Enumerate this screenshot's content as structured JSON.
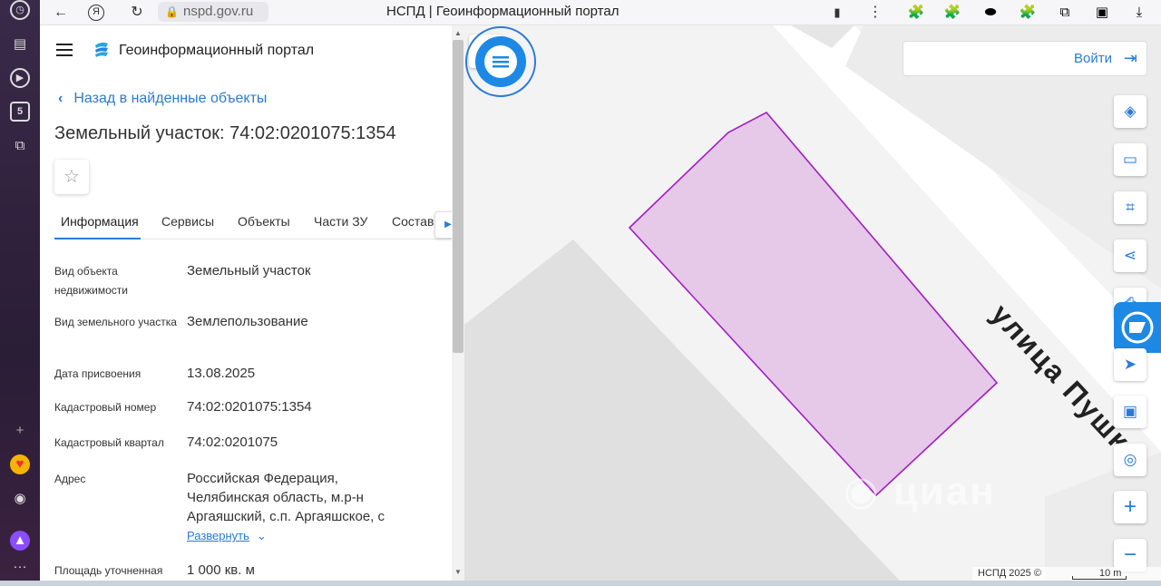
{
  "browser": {
    "url": "nspd.gov.ru",
    "tab_title": "НСПД | Геоинформационный портал"
  },
  "rail": {
    "badge_text": "5"
  },
  "panel": {
    "portal_title": "Геоинформационный портал",
    "back_link": "Назад в найденные объекты",
    "object_title": "Земельный участок: 74:02:0201075:1354",
    "tabs": [
      "Информация",
      "Сервисы",
      "Объекты",
      "Части ЗУ",
      "Состав"
    ],
    "active_tab_index": 0,
    "properties": [
      {
        "label": "Вид объекта недвижимости",
        "value": "Земельный участок"
      },
      {
        "label": "Вид земельного участка",
        "value": "Землепользование"
      },
      {
        "label": "Дата присвоения",
        "value": "13.08.2025"
      },
      {
        "label": "Кадастровый номер",
        "value": "74:02:0201075:1354"
      },
      {
        "label": "Кадастровый квартал",
        "value": "74:02:0201075"
      },
      {
        "label": "Адрес",
        "value": "Российская Федерация, Челябинская область, м.р-н Аргаяшский, с.п. Аргаяшское, с"
      },
      {
        "label": "Площадь уточненная",
        "value": "1 000 кв. м"
      }
    ],
    "expand_link": "Развернуть"
  },
  "map": {
    "login_label": "Войти",
    "street_label": "улица Пушк",
    "watermark": "циан",
    "attribution": "НСПД 2025 ©",
    "scale": "10 m",
    "parcel_fill": "#e6c8e8",
    "parcel_stroke": "#a020c0",
    "accent": "#2a7ad6"
  }
}
